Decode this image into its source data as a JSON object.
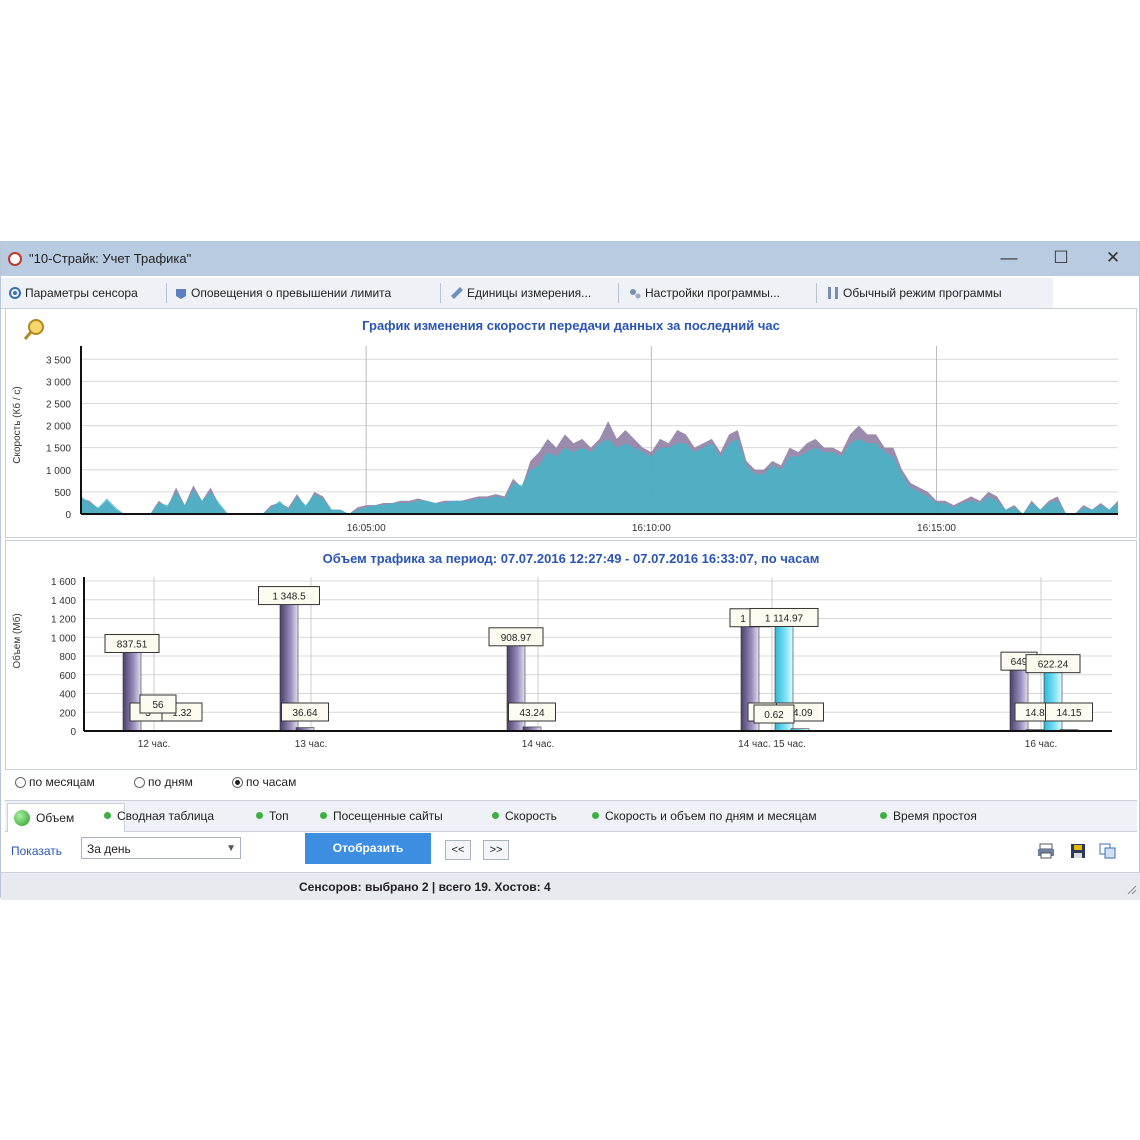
{
  "window": {
    "title": "\"10-Страйк: Учет Трафика\"",
    "minimize": "—",
    "maximize": "☐",
    "close": "✕"
  },
  "toolbar": {
    "items": [
      {
        "label": "Параметры сенсора",
        "icon": "sensor-icon"
      },
      {
        "label": "Оповещения о превышении лимита",
        "icon": "alert-icon"
      },
      {
        "label": "Единицы измерения...",
        "icon": "ruler-icon"
      },
      {
        "label": "Настройки программы...",
        "icon": "settings-icon"
      },
      {
        "label": "Обычный режим программы",
        "icon": "mode-icon"
      }
    ]
  },
  "speed_chart": {
    "title": "График изменения скорости передачи данных за последний час",
    "ylabel": "Скорость (Кб / с)",
    "y_ticks": [
      "3 500",
      "3 000",
      "2 500",
      "2 000",
      "1 500",
      "1 000",
      "500",
      "0"
    ],
    "x_ticks": [
      "16:05:00",
      "16:10:00",
      "16:15:00"
    ]
  },
  "volume_chart": {
    "title": "Объем трафика за период: 07.07.2016 12:27:49 - 07.07.2016 16:33:07, по часам",
    "ylabel": "Объем (Мб)",
    "y_ticks": [
      "1 600",
      "1 400",
      "1 200",
      "1 000",
      "800",
      "600",
      "400",
      "200",
      "0"
    ],
    "x_ticks": [
      "12 час.",
      "13 час.",
      "14 час.",
      "14 час. 15 час.",
      "16 час."
    ]
  },
  "chart_data": [
    {
      "type": "area",
      "title": "График изменения скорости передачи данных за последний час",
      "ylabel": "Скорость (Кб / с)",
      "ylim": [
        0,
        3800
      ],
      "x_ticks": [
        "16:05:00",
        "16:10:00",
        "16:15:00"
      ],
      "grid": true,
      "series": [
        {
          "color": "#8a78a0",
          "x": [
            0,
            1,
            2,
            3,
            4,
            5,
            6,
            7,
            8,
            9,
            10,
            11,
            12,
            13,
            14,
            15,
            16,
            17,
            18,
            19,
            20,
            21,
            22,
            23,
            24,
            25,
            26,
            27,
            28,
            29,
            30,
            31,
            32,
            33,
            34,
            35,
            36,
            37,
            38,
            39,
            40,
            41,
            42,
            43,
            44,
            45,
            46,
            47,
            48,
            49,
            50,
            51,
            52,
            53,
            54,
            55,
            56,
            57,
            58,
            59,
            60,
            61,
            62,
            63,
            64,
            65,
            66,
            67,
            68,
            69,
            70,
            71,
            72,
            73,
            74,
            75,
            76,
            77,
            78,
            79,
            80,
            81,
            82,
            83,
            84,
            85,
            86,
            87,
            88,
            89,
            90,
            91,
            92,
            93,
            94,
            95,
            96,
            97,
            98,
            99,
            100,
            101,
            102,
            103,
            104,
            105,
            106,
            107,
            108,
            109,
            110,
            111,
            112,
            113,
            114,
            115,
            116,
            117,
            118,
            119,
            120
          ],
          "y": [
            350,
            300,
            120,
            300,
            100,
            0,
            0,
            0,
            0,
            300,
            150,
            600,
            200,
            650,
            300,
            600,
            200,
            0,
            0,
            0,
            0,
            0,
            200,
            250,
            150,
            450,
            150,
            500,
            400,
            100,
            100,
            0,
            150,
            200,
            200,
            250,
            250,
            300,
            300,
            350,
            300,
            250,
            300,
            300,
            300,
            350,
            400,
            400,
            450,
            400,
            800,
            600,
            1200,
            1400,
            1700,
            1500,
            1800,
            1600,
            1700,
            1500,
            1700,
            2100,
            1700,
            1900,
            1700,
            1500,
            1400,
            1700,
            1600,
            1900,
            1800,
            1500,
            1600,
            1700,
            1400,
            1800,
            1900,
            1200,
            1000,
            1000,
            1200,
            1100,
            1500,
            1400,
            1600,
            1700,
            1500,
            1500,
            1400,
            1800,
            2000,
            1800,
            1800,
            1500,
            1500,
            1000,
            700,
            600,
            500,
            300,
            300,
            200,
            300,
            400,
            300,
            500,
            400,
            100,
            200,
            0,
            300,
            100,
            300,
            400,
            0,
            0,
            200,
            100,
            250,
            100,
            300
          ]
        },
        {
          "color": "#40b8c8",
          "x": [
            0,
            1,
            2,
            3,
            4,
            5,
            6,
            7,
            8,
            9,
            10,
            11,
            12,
            13,
            14,
            15,
            16,
            17,
            18,
            19,
            20,
            21,
            22,
            23,
            24,
            25,
            26,
            27,
            28,
            29,
            30,
            31,
            32,
            33,
            34,
            35,
            36,
            37,
            38,
            39,
            40,
            41,
            42,
            43,
            44,
            45,
            46,
            47,
            48,
            49,
            50,
            51,
            52,
            53,
            54,
            55,
            56,
            57,
            58,
            59,
            60,
            61,
            62,
            63,
            64,
            65,
            66,
            67,
            68,
            69,
            70,
            71,
            72,
            73,
            74,
            75,
            76,
            77,
            78,
            79,
            80,
            81,
            82,
            83,
            84,
            85,
            86,
            87,
            88,
            89,
            90,
            91,
            92,
            93,
            94,
            95,
            96,
            97,
            98,
            99,
            100,
            101,
            102,
            103,
            104,
            105,
            106,
            107,
            108,
            109,
            110,
            111,
            112,
            113,
            114,
            115,
            116,
            117,
            118,
            119,
            120
          ],
          "y": [
            400,
            250,
            150,
            350,
            150,
            0,
            0,
            0,
            0,
            250,
            200,
            500,
            200,
            550,
            300,
            500,
            250,
            0,
            0,
            0,
            0,
            0,
            150,
            300,
            100,
            400,
            200,
            450,
            350,
            100,
            100,
            0,
            100,
            150,
            200,
            200,
            250,
            250,
            250,
            300,
            300,
            250,
            250,
            300,
            300,
            300,
            350,
            350,
            400,
            350,
            700,
            650,
            1000,
            1100,
            1400,
            1300,
            1500,
            1400,
            1500,
            1400,
            1600,
            1700,
            1500,
            1600,
            1500,
            1400,
            1300,
            1500,
            1500,
            1600,
            1600,
            1400,
            1500,
            1600,
            1300,
            1600,
            1700,
            1100,
            900,
            900,
            1100,
            1000,
            1300,
            1300,
            1400,
            1500,
            1400,
            1400,
            1300,
            1600,
            1700,
            1600,
            1600,
            1400,
            1300,
            900,
            600,
            500,
            400,
            250,
            250,
            150,
            250,
            300,
            250,
            400,
            300,
            100,
            150,
            0,
            250,
            100,
            250,
            300,
            0,
            0,
            150,
            100,
            200,
            100,
            250
          ]
        }
      ]
    },
    {
      "type": "bar",
      "title": "Объем трафика за период: 07.07.2016 12:27:49 - 07.07.2016 16:33:07, по часам",
      "ylabel": "Объем (Мб)",
      "ylim": [
        0,
        1600
      ],
      "categories": [
        "12 час.",
        "13 час.",
        "14 час.",
        "14 час. 15 час.",
        "16 час."
      ],
      "grid": true,
      "series": [
        {
          "color": "#6a5f8a",
          "values": [
            837.51,
            1348.5,
            908.97,
            1112,
            649
          ],
          "labels": [
            "837.51",
            "1 348.5",
            "908.97",
            "1 12",
            "649"
          ]
        },
        {
          "color": "#4bd0e8",
          "values": [
            0,
            0,
            0,
            1114.97,
            622.24
          ],
          "labels": [
            "",
            "",
            "",
            "1 114.97",
            "622.24"
          ]
        },
        {
          "color": "#6a5f8a",
          "values": [
            5,
            36.64,
            43.24,
            1,
            14.8
          ],
          "labels": [
            "5",
            "36.64",
            "43.24",
            "1",
            "14.8"
          ]
        },
        {
          "color": "#4bd0e8",
          "values": [
            1.32,
            0,
            0,
            24.09,
            14.15
          ],
          "labels": [
            "1.32",
            "",
            "",
            "24.09",
            "14.15"
          ]
        }
      ],
      "extra_labels": [
        "56",
        "0.62"
      ]
    }
  ],
  "view_options": {
    "by_month": "по месяцам",
    "by_day": "по дням",
    "by_hour": "по часам",
    "selected": "by_hour"
  },
  "tabs": [
    {
      "label": "Объем",
      "active": true
    },
    {
      "label": "Сводная таблица"
    },
    {
      "label": "Топ"
    },
    {
      "label": "Посещенные сайты"
    },
    {
      "label": "Скорость"
    },
    {
      "label": "Скорость и объем по дням и месяцам"
    },
    {
      "label": "Время простоя"
    }
  ],
  "controls": {
    "show_label": "Показать",
    "period_value": "За день",
    "display_button": "Отобразить",
    "prev": "<<",
    "next": ">>",
    "icons": [
      "print-icon",
      "save-icon",
      "copy-icon"
    ]
  },
  "status": {
    "text": "Сенсоров: выбрано 2 | всего 19. Хостов: 4"
  }
}
